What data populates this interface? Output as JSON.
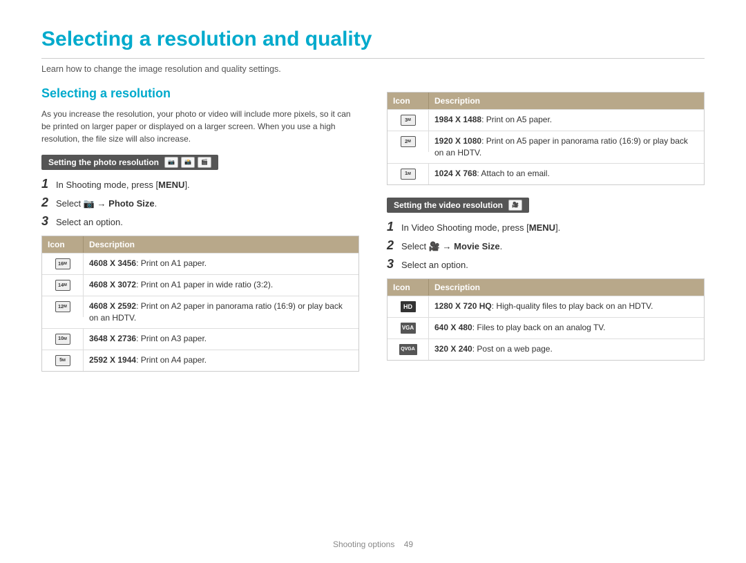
{
  "page": {
    "title": "Selecting a resolution and quality",
    "subtitle": "Learn how to change the image resolution and quality settings."
  },
  "left": {
    "section_heading": "Selecting a resolution",
    "section_desc": "As you increase the resolution, your photo or video will include more pixels, so it can be printed on larger paper or displayed on a larger screen. When you use a high resolution, the file size will also increase.",
    "photo_bar_label": "Setting the photo resolution",
    "steps": [
      {
        "num": "1",
        "text": "In Shooting mode, press [",
        "bold": "MENU",
        "after": "]."
      },
      {
        "num": "2",
        "text": "Select ",
        "icon": "camera",
        "arrow": " → ",
        "bold_end": "Photo Size",
        "after": "."
      },
      {
        "num": "3",
        "text": "Select an option."
      }
    ],
    "photo_table": {
      "headers": [
        "Icon",
        "Description"
      ],
      "rows": [
        {
          "icon": "16M",
          "desc_bold": "4608 X 3456",
          "desc": ": Print on A1 paper."
        },
        {
          "icon": "14M",
          "desc_bold": "4608 X 3072",
          "desc": ": Print on A1 paper in wide ratio (3:2)."
        },
        {
          "icon": "12M",
          "desc_bold": "4608 X 2592",
          "desc": ": Print on A2 paper in panorama ratio (16:9) or play back on an HDTV."
        },
        {
          "icon": "10M",
          "desc_bold": "3648 X 2736",
          "desc": ": Print on A3 paper."
        },
        {
          "icon": "5M",
          "desc_bold": "2592 X 1944",
          "desc": ": Print on A4 paper."
        }
      ]
    }
  },
  "right": {
    "photo_table2": {
      "headers": [
        "Icon",
        "Description"
      ],
      "rows": [
        {
          "icon": "3M",
          "desc_bold": "1984 X 1488",
          "desc": ": Print on A5 paper."
        },
        {
          "icon": "2M",
          "desc_bold": "1920 X 1080",
          "desc": ": Print on A5 paper in panorama ratio (16:9) or play back on an HDTV."
        },
        {
          "icon": "1M",
          "desc_bold": "1024 X 768",
          "desc": ": Attach to an email."
        }
      ]
    },
    "video_bar_label": "Setting the video resolution",
    "video_steps": [
      {
        "num": "1",
        "text": "In Video Shooting mode, press [",
        "bold": "MENU",
        "after": "]."
      },
      {
        "num": "2",
        "text": "Select ",
        "icon": "video",
        "arrow": " → ",
        "bold_end": "Movie Size",
        "after": "."
      },
      {
        "num": "3",
        "text": "Select an option."
      }
    ],
    "video_table": {
      "headers": [
        "Icon",
        "Description"
      ],
      "rows": [
        {
          "icon": "HD",
          "type": "hd",
          "desc_bold": "1280 X 720 HQ",
          "desc": ": High-quality files to play back on an HDTV."
        },
        {
          "icon": "VGA",
          "type": "vga",
          "desc_bold": "640 X 480",
          "desc": ": Files to play back on an analog TV."
        },
        {
          "icon": "QVGA",
          "type": "qvga",
          "desc_bold": "320 X 240",
          "desc": ": Post on a web page."
        }
      ]
    }
  },
  "footer": {
    "text": "Shooting options",
    "page_num": "49"
  }
}
